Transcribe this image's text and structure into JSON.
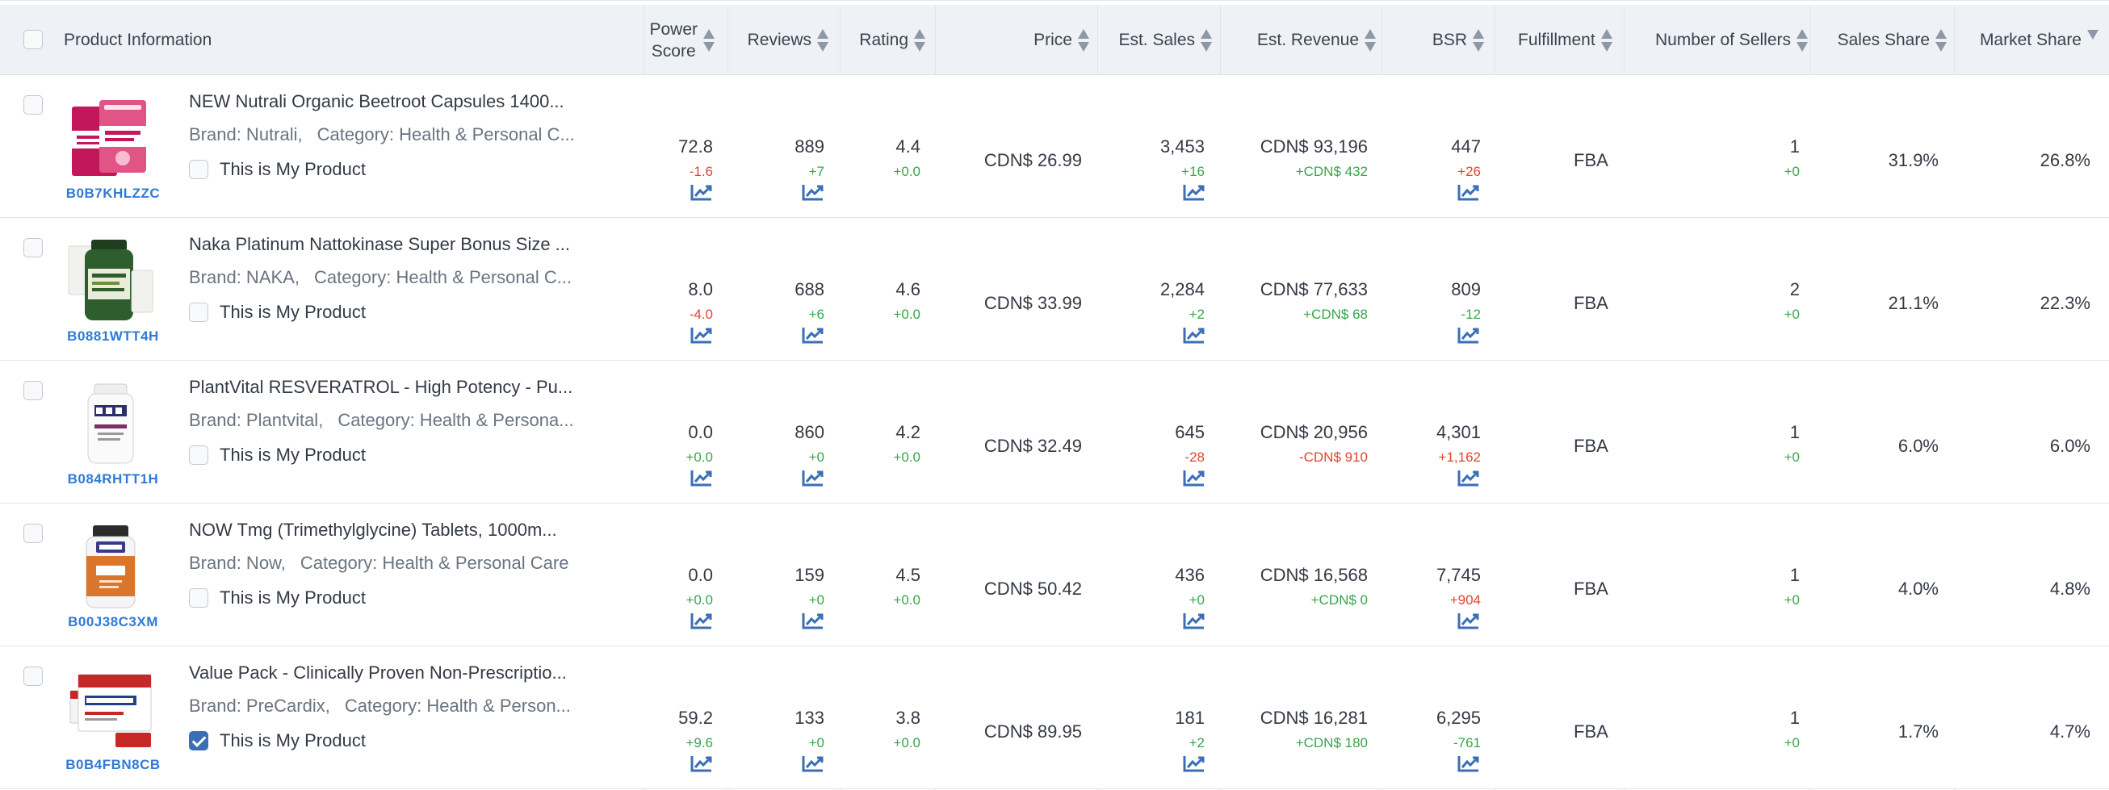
{
  "header": {
    "product_info": "Product Information",
    "power_score_l1": "Power",
    "power_score_l2": "Score",
    "reviews": "Reviews",
    "rating": "Rating",
    "price": "Price",
    "est_sales": "Est. Sales",
    "est_revenue": "Est. Revenue",
    "bsr": "BSR",
    "fulfillment": "Fulfillment",
    "num_sellers": "Number of Sellers",
    "sales_share": "Sales Share",
    "market_share": "Market Share"
  },
  "mine_label": "This is My Product",
  "rows": [
    {
      "asin": "B0B7KHLZZC",
      "title": "NEW Nutrali Organic Beetroot Capsules 1400...",
      "brand": "Brand: Nutrali,",
      "category": "Category: Health & Personal C...",
      "mine": false,
      "image_icon": "beetroot-capsules-box",
      "power_score": "72.8",
      "power_score_delta": "-1.6",
      "power_score_sign": "neg",
      "reviews": "889",
      "reviews_delta": "+7",
      "reviews_sign": "pos",
      "rating": "4.4",
      "rating_delta": "+0.0",
      "rating_sign": "pos",
      "price": "CDN$ 26.99",
      "est_sales": "3,453",
      "est_sales_delta": "+16",
      "est_sales_sign": "pos",
      "est_revenue": "CDN$ 93,196",
      "est_revenue_delta": "+CDN$ 432",
      "est_revenue_sign": "pos",
      "bsr": "447",
      "bsr_delta": "+26",
      "bsr_sign": "neg",
      "fulfillment": "FBA",
      "sellers": "1",
      "sellers_delta": "+0",
      "sellers_sign": "pos",
      "sales_share": "31.9%",
      "market_share": "26.8%"
    },
    {
      "asin": "B0881WTT4H",
      "title": "Naka Platinum Nattokinase Super Bonus Size ...",
      "brand": "Brand: NAKA,",
      "category": "Category: Health & Personal C...",
      "mine": false,
      "image_icon": "green-supplement-bottle",
      "power_score": "8.0",
      "power_score_delta": "-4.0",
      "power_score_sign": "neg",
      "reviews": "688",
      "reviews_delta": "+6",
      "reviews_sign": "pos",
      "rating": "4.6",
      "rating_delta": "+0.0",
      "rating_sign": "pos",
      "price": "CDN$ 33.99",
      "est_sales": "2,284",
      "est_sales_delta": "+2",
      "est_sales_sign": "pos",
      "est_revenue": "CDN$ 77,633",
      "est_revenue_delta": "+CDN$ 68",
      "est_revenue_sign": "pos",
      "bsr": "809",
      "bsr_delta": "-12",
      "bsr_sign": "pos",
      "fulfillment": "FBA",
      "sellers": "2",
      "sellers_delta": "+0",
      "sellers_sign": "pos",
      "sales_share": "21.1%",
      "market_share": "22.3%"
    },
    {
      "asin": "B084RHTT1H",
      "title": "PlantVital RESVERATROL - High Potency - Pu...",
      "brand": "Brand: Plantvital,",
      "category": "Category: Health & Persona...",
      "mine": false,
      "image_icon": "white-supplement-bottle",
      "power_score": "0.0",
      "power_score_delta": "+0.0",
      "power_score_sign": "pos",
      "reviews": "860",
      "reviews_delta": "+0",
      "reviews_sign": "pos",
      "rating": "4.2",
      "rating_delta": "+0.0",
      "rating_sign": "pos",
      "price": "CDN$ 32.49",
      "est_sales": "645",
      "est_sales_delta": "-28",
      "est_sales_sign": "neg",
      "est_revenue": "CDN$ 20,956",
      "est_revenue_delta": "-CDN$ 910",
      "est_revenue_sign": "neg",
      "bsr": "4,301",
      "bsr_delta": "+1,162",
      "bsr_sign": "neg",
      "fulfillment": "FBA",
      "sellers": "1",
      "sellers_delta": "+0",
      "sellers_sign": "pos",
      "sales_share": "6.0%",
      "market_share": "6.0%"
    },
    {
      "asin": "B00J38C3XM",
      "title": "NOW Tmg (Trimethylglycine) Tablets, 1000m...",
      "brand": "Brand: Now,",
      "category": "Category: Health & Personal Care",
      "mine": false,
      "image_icon": "now-tmg-bottle",
      "power_score": "0.0",
      "power_score_delta": "+0.0",
      "power_score_sign": "pos",
      "reviews": "159",
      "reviews_delta": "+0",
      "reviews_sign": "pos",
      "rating": "4.5",
      "rating_delta": "+0.0",
      "rating_sign": "pos",
      "price": "CDN$ 50.42",
      "est_sales": "436",
      "est_sales_delta": "+0",
      "est_sales_sign": "pos",
      "est_revenue": "CDN$ 16,568",
      "est_revenue_delta": "+CDN$ 0",
      "est_revenue_sign": "pos",
      "bsr": "7,745",
      "bsr_delta": "+904",
      "bsr_sign": "neg",
      "fulfillment": "FBA",
      "sellers": "1",
      "sellers_delta": "+0",
      "sellers_sign": "pos",
      "sales_share": "4.0%",
      "market_share": "4.8%"
    },
    {
      "asin": "B0B4FBN8CB",
      "title": "Value Pack - Clinically Proven Non-Prescriptio...",
      "brand": "Brand: PreCardix,",
      "category": "Category: Health & Person...",
      "mine": true,
      "image_icon": "precardix-value-pack",
      "power_score": "59.2",
      "power_score_delta": "+9.6",
      "power_score_sign": "pos",
      "reviews": "133",
      "reviews_delta": "+0",
      "reviews_sign": "pos",
      "rating": "3.8",
      "rating_delta": "+0.0",
      "rating_sign": "pos",
      "price": "CDN$ 89.95",
      "est_sales": "181",
      "est_sales_delta": "+2",
      "est_sales_sign": "pos",
      "est_revenue": "CDN$ 16,281",
      "est_revenue_delta": "+CDN$ 180",
      "est_revenue_sign": "pos",
      "bsr": "6,295",
      "bsr_delta": "-761",
      "bsr_sign": "pos",
      "fulfillment": "FBA",
      "sellers": "1",
      "sellers_delta": "+0",
      "sellers_sign": "pos",
      "sales_share": "1.7%",
      "market_share": "4.7%"
    }
  ],
  "colors": {
    "header_bg": "#eef2f6",
    "asin_link": "#2f7ad6",
    "positive": "#3aa54a",
    "negative": "#e2452f",
    "trend_icon": "#3b6fb5",
    "checkbox_checked": "#3b6fb5"
  }
}
